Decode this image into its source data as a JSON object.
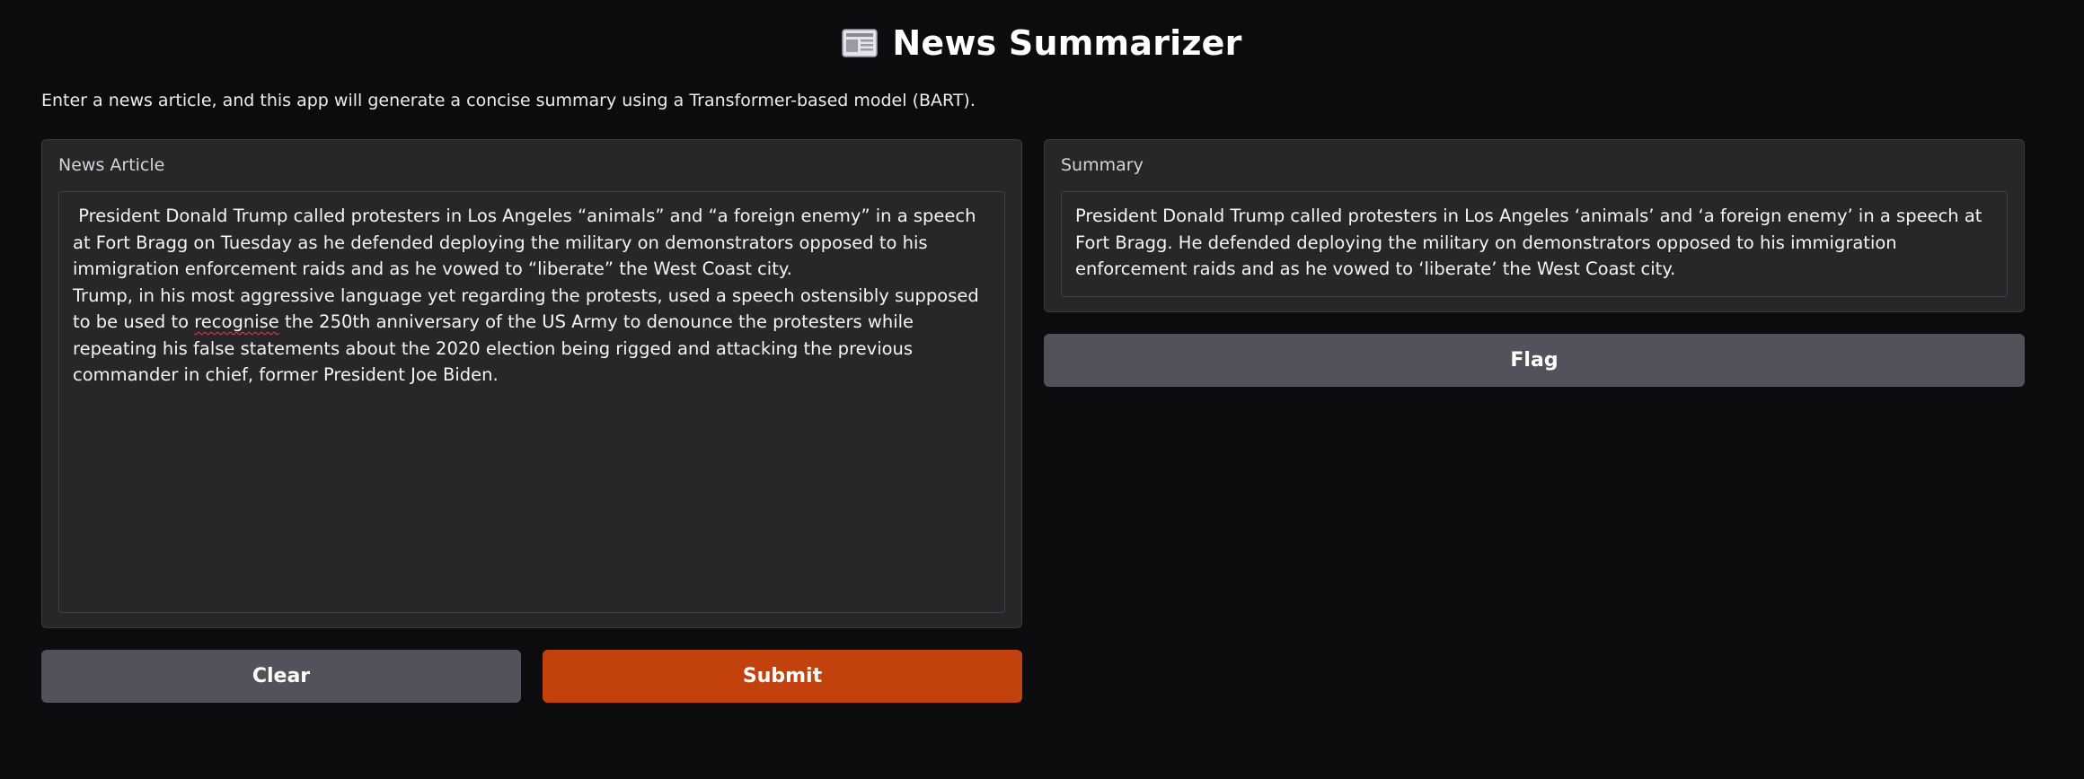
{
  "header": {
    "icon": "newspaper-icon",
    "title": "News Summarizer"
  },
  "description": "Enter a news article, and this app will generate a concise summary using a Transformer-based model (BART).",
  "input_panel": {
    "label": "News Article",
    "value_part1": " President Donald Trump called protesters in Los Angeles “animals” and “a foreign enemy” in a speech at Fort Bragg on Tuesday as he defended deploying the military on demonstrators opposed to his immigration enforcement raids and as he vowed to “liberate” the West Coast city.\nTrump, in his most aggressive language yet regarding the protests, used a speech ostensibly supposed to be used to ",
    "value_misspelled": "recognise",
    "value_part2": " the 250th anniversary of the US Army to denounce the protesters while repeating his false statements about the 2020 election being rigged and attacking the previous commander in chief, former President Joe Biden."
  },
  "output_panel": {
    "label": "Summary",
    "value": "President Donald Trump called protesters in Los Angeles ‘animals’ and ‘a foreign enemy’ in a speech at Fort Bragg. He defended deploying the military on demonstrators opposed to his immigration enforcement raids and as he vowed to ‘liberate’ the West Coast city."
  },
  "buttons": {
    "clear_label": "Clear",
    "submit_label": "Submit",
    "flag_label": "Flag"
  },
  "colors": {
    "background": "#0c0c0f",
    "panel": "#27272a",
    "secondary_button": "#52525b",
    "primary_button": "#c2410c"
  }
}
